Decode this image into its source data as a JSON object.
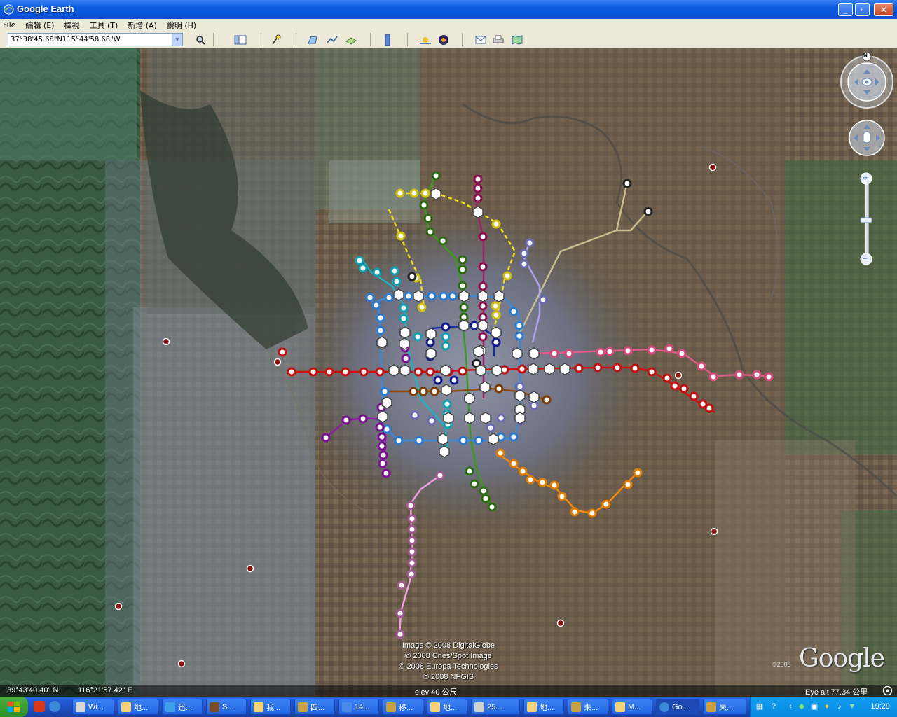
{
  "window": {
    "title": "Google Earth",
    "minimize": "_",
    "maximize": "▫",
    "close": "✕"
  },
  "menu": [
    {
      "label": "File"
    },
    {
      "label": "編輯 (E)"
    },
    {
      "label": "檢視"
    },
    {
      "label": "工具 (T)"
    },
    {
      "label": "新增 (A)"
    },
    {
      "label": "說明 (H)"
    }
  ],
  "toolbar": {
    "search_value": "37°38'45.68\"N115°44'58.68\"W",
    "icons": [
      "search-icon",
      "sidebar-icon",
      "placemark-icon",
      "polygon-icon",
      "path-icon",
      "overlay-icon",
      "ruler-icon",
      "sunlight-icon",
      "sky-icon",
      "email-icon",
      "print-icon",
      "maps-icon"
    ]
  },
  "map": {
    "credits": [
      "Image © 2008 DigitalGlobe",
      "© 2008 Cnes/Spot Image",
      "© 2008 Europa Technologies",
      "© 2008 NFGIS"
    ],
    "logo_text": "Google",
    "logo_year": "©2008",
    "nav_north": "N",
    "zoom_in": "+",
    "zoom_out": "−"
  },
  "status": {
    "latitude": "39°43'40.40\" N",
    "longitude": "116°21'57.42\" E",
    "elevation": "elev   40 公尺",
    "eye_alt": "Eye alt    77.34 公里"
  },
  "taskbar": {
    "tasks": [
      {
        "label": "Wi...",
        "icon_color": "#d8d8d8"
      },
      {
        "label": "地...",
        "icon_color": "#f3d27a"
      },
      {
        "label": "迅...",
        "icon_color": "#3da0e8"
      },
      {
        "label": "S...",
        "icon_color": "#7a4a2a"
      },
      {
        "label": "我...",
        "icon_color": "#f3d27a"
      },
      {
        "label": "四...",
        "icon_color": "#c8a040"
      },
      {
        "label": "14...",
        "icon_color": "#4a8ae8"
      },
      {
        "label": "移...",
        "icon_color": "#c8a040"
      },
      {
        "label": "地...",
        "icon_color": "#f3d27a"
      },
      {
        "label": "25...",
        "icon_color": "#d0d0d0"
      },
      {
        "label": "地...",
        "icon_color": "#f3d27a"
      },
      {
        "label": "未...",
        "icon_color": "#c8a040"
      },
      {
        "label": "M...",
        "icon_color": "#f3d27a"
      },
      {
        "label": "Go...",
        "icon_color": "#3a8ad8",
        "active": true
      },
      {
        "label": "未...",
        "icon_color": "#c8a040"
      }
    ],
    "clock": "19:29"
  }
}
